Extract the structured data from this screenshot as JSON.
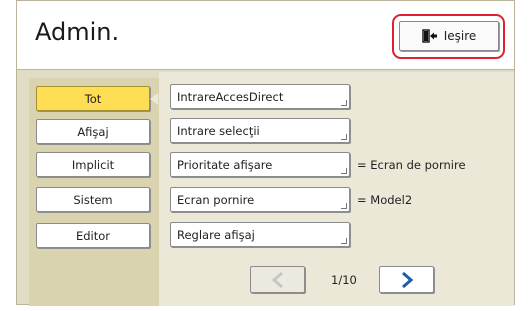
{
  "header": {
    "title": "Admin.",
    "exit_label": "Ieşire"
  },
  "categories": [
    {
      "label": "Tot",
      "active": true
    },
    {
      "label": "Afişaj",
      "active": false
    },
    {
      "label": "Implicit",
      "active": false
    },
    {
      "label": "Sistem",
      "active": false
    },
    {
      "label": "Editor",
      "active": false
    }
  ],
  "items": [
    {
      "label": "IntrareAccesDirect",
      "value": ""
    },
    {
      "label": "Intrare selecţii",
      "value": ""
    },
    {
      "label": "Prioritate afişare",
      "value": "= Ecran de pornire"
    },
    {
      "label": "Ecran pornire",
      "value": "= Model2"
    },
    {
      "label": "Reglare afişaj",
      "value": ""
    }
  ],
  "pager": {
    "page": "1/10"
  },
  "colors": {
    "highlight": "#e0202e",
    "active_category": "#ffdd55",
    "arrow": "#1d5fa6"
  }
}
